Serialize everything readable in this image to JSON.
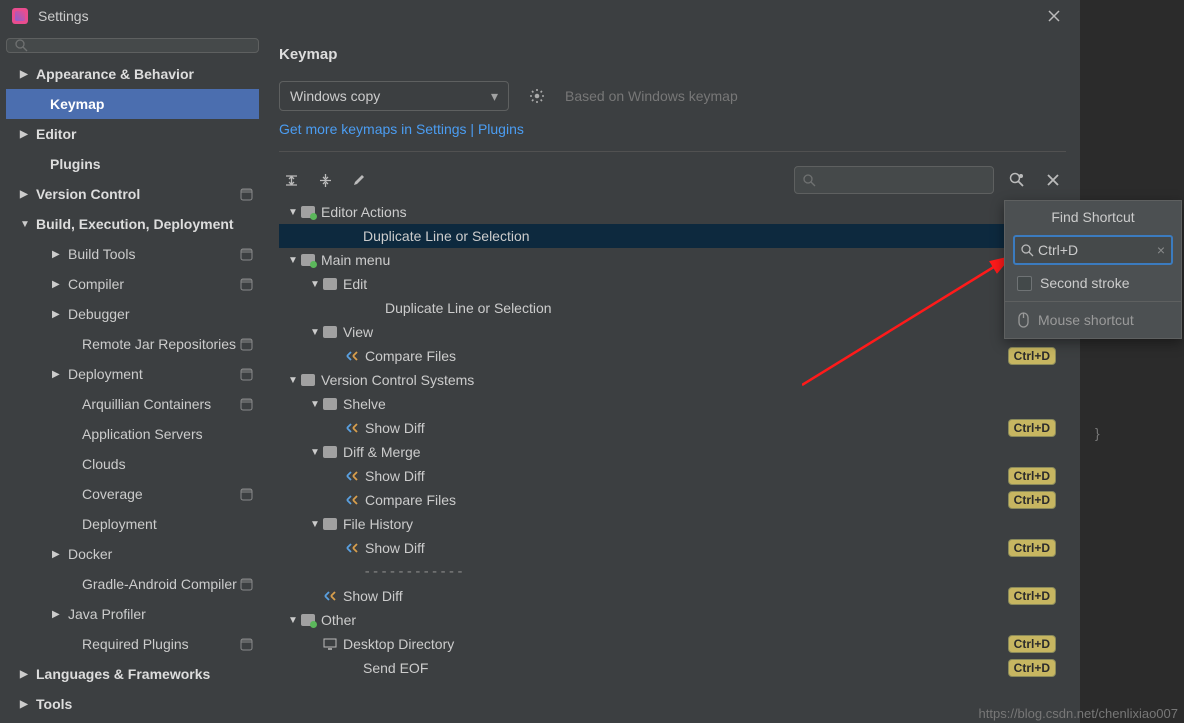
{
  "window": {
    "title": "Settings"
  },
  "sidebar": {
    "search_placeholder": "",
    "items": [
      {
        "label": "Appearance & Behavior",
        "bold": true,
        "caret": "right",
        "level": 0
      },
      {
        "label": "Keymap",
        "bold": true,
        "caret": "none",
        "level": 1,
        "selected": true
      },
      {
        "label": "Editor",
        "bold": true,
        "caret": "right",
        "level": 0
      },
      {
        "label": "Plugins",
        "bold": true,
        "caret": "none",
        "level": 1
      },
      {
        "label": "Version Control",
        "bold": true,
        "caret": "right",
        "level": 0,
        "gear": true
      },
      {
        "label": "Build, Execution, Deployment",
        "bold": true,
        "caret": "down",
        "level": 0
      },
      {
        "label": "Build Tools",
        "caret": "right",
        "level": 2,
        "gear": true
      },
      {
        "label": "Compiler",
        "caret": "right",
        "level": 2,
        "gear": true
      },
      {
        "label": "Debugger",
        "caret": "right",
        "level": 2
      },
      {
        "label": "Remote Jar Repositories",
        "caret": "none",
        "level": 3,
        "gear": true
      },
      {
        "label": "Deployment",
        "caret": "right",
        "level": 2,
        "gear": true
      },
      {
        "label": "Arquillian Containers",
        "caret": "none",
        "level": 3,
        "gear": true
      },
      {
        "label": "Application Servers",
        "caret": "none",
        "level": 3
      },
      {
        "label": "Clouds",
        "caret": "none",
        "level": 3
      },
      {
        "label": "Coverage",
        "caret": "none",
        "level": 3,
        "gear": true
      },
      {
        "label": "Deployment",
        "caret": "none",
        "level": 3
      },
      {
        "label": "Docker",
        "caret": "right",
        "level": 2
      },
      {
        "label": "Gradle-Android Compiler",
        "caret": "none",
        "level": 3,
        "gear": true
      },
      {
        "label": "Java Profiler",
        "caret": "right",
        "level": 2
      },
      {
        "label": "Required Plugins",
        "caret": "none",
        "level": 3,
        "gear": true
      },
      {
        "label": "Languages & Frameworks",
        "bold": true,
        "caret": "right",
        "level": 0
      },
      {
        "label": "Tools",
        "bold": true,
        "caret": "right",
        "level": 0
      }
    ]
  },
  "main": {
    "title": "Keymap",
    "scheme": "Windows copy",
    "based_on": "Based on Windows keymap",
    "more_link": "Get more keymaps in Settings | Plugins"
  },
  "actions": [
    {
      "indent": 0,
      "caret": "down",
      "icon": "folder-green",
      "label": "Editor Actions"
    },
    {
      "indent": 2,
      "label": "Duplicate Line or Selection",
      "selected": true
    },
    {
      "indent": 0,
      "caret": "down",
      "icon": "folder-green",
      "label": "Main menu"
    },
    {
      "indent": 1,
      "caret": "down",
      "icon": "folder",
      "label": "Edit"
    },
    {
      "indent": 3,
      "label": "Duplicate Line or Selection"
    },
    {
      "indent": 1,
      "caret": "down",
      "icon": "folder",
      "label": "View"
    },
    {
      "indent": 2,
      "icon": "action",
      "label": "Compare Files",
      "badge": "Ctrl+D"
    },
    {
      "indent": 0,
      "caret": "down",
      "icon": "folder",
      "label": "Version Control Systems"
    },
    {
      "indent": 1,
      "caret": "down",
      "icon": "folder",
      "label": "Shelve"
    },
    {
      "indent": 2,
      "icon": "action",
      "label": "Show Diff",
      "badge": "Ctrl+D"
    },
    {
      "indent": 1,
      "caret": "down",
      "icon": "folder",
      "label": "Diff & Merge"
    },
    {
      "indent": 2,
      "icon": "action",
      "label": "Show Diff",
      "badge": "Ctrl+D"
    },
    {
      "indent": 2,
      "icon": "action",
      "label": "Compare Files",
      "badge": "Ctrl+D"
    },
    {
      "indent": 1,
      "caret": "down",
      "icon": "folder",
      "label": "File History"
    },
    {
      "indent": 2,
      "icon": "action",
      "label": "Show Diff",
      "badge": "Ctrl+D"
    },
    {
      "indent": 2,
      "dashes": "------------"
    },
    {
      "indent": 1,
      "icon": "action",
      "label": "Show Diff",
      "badge": "Ctrl+D"
    },
    {
      "indent": 0,
      "caret": "down",
      "icon": "folder-green",
      "label": "Other"
    },
    {
      "indent": 1,
      "icon": "desktop",
      "label": "Desktop Directory",
      "badge": "Ctrl+D"
    },
    {
      "indent": 2,
      "label": "Send EOF",
      "badge": "Ctrl+D"
    }
  ],
  "popup": {
    "title": "Find Shortcut",
    "input_value": "Ctrl+D",
    "second_stroke": "Second stroke",
    "mouse_shortcut": "Mouse shortcut"
  },
  "watermark": "https://blog.csdn.net/chenlixiao007",
  "bgcode": "}"
}
